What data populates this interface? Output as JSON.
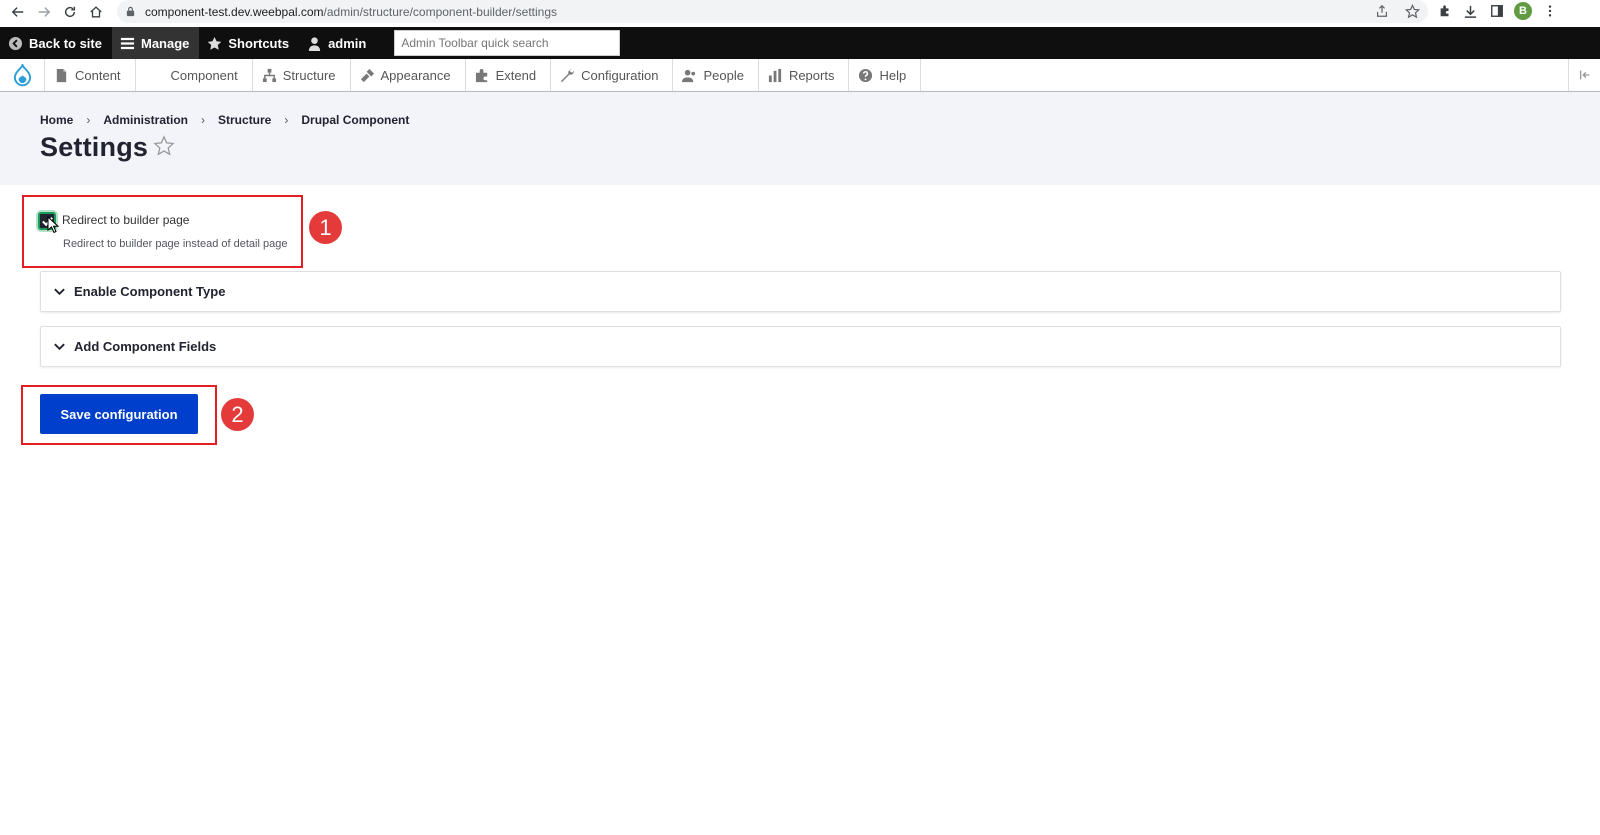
{
  "browser": {
    "url_host": "component-test.dev.weebpal.com",
    "url_path": "/admin/structure/component-builder/settings",
    "profile_initial": "B"
  },
  "toolbar": {
    "back": "Back to site",
    "manage": "Manage",
    "shortcuts": "Shortcuts",
    "user": "admin",
    "search_placeholder": "Admin Toolbar quick search"
  },
  "tray": {
    "items": [
      {
        "label": "Content",
        "icon": "file-icon"
      },
      {
        "label": "Component",
        "icon": ""
      },
      {
        "label": "Structure",
        "icon": "sitemap-icon"
      },
      {
        "label": "Appearance",
        "icon": "paintbrush-icon"
      },
      {
        "label": "Extend",
        "icon": "puzzle-icon"
      },
      {
        "label": "Configuration",
        "icon": "wrench-icon"
      },
      {
        "label": "People",
        "icon": "people-icon"
      },
      {
        "label": "Reports",
        "icon": "bar-chart-icon"
      },
      {
        "label": "Help",
        "icon": "help-icon"
      }
    ]
  },
  "breadcrumb": [
    "Home",
    "Administration",
    "Structure",
    "Drupal Component"
  ],
  "page": {
    "title": "Settings"
  },
  "form": {
    "redirect_label": "Redirect to builder page",
    "redirect_description": "Redirect to builder page instead of detail page",
    "redirect_checked": true,
    "sections": [
      "Enable Component Type",
      "Add Component Fields"
    ],
    "save_label": "Save configuration"
  },
  "annotations": [
    "1",
    "2"
  ],
  "colors": {
    "toolbar_bg": "#0f0f0f",
    "primary_button": "#003ecc",
    "annotation_red": "#e31e24",
    "checkbox_focus": "#1b9a59"
  }
}
